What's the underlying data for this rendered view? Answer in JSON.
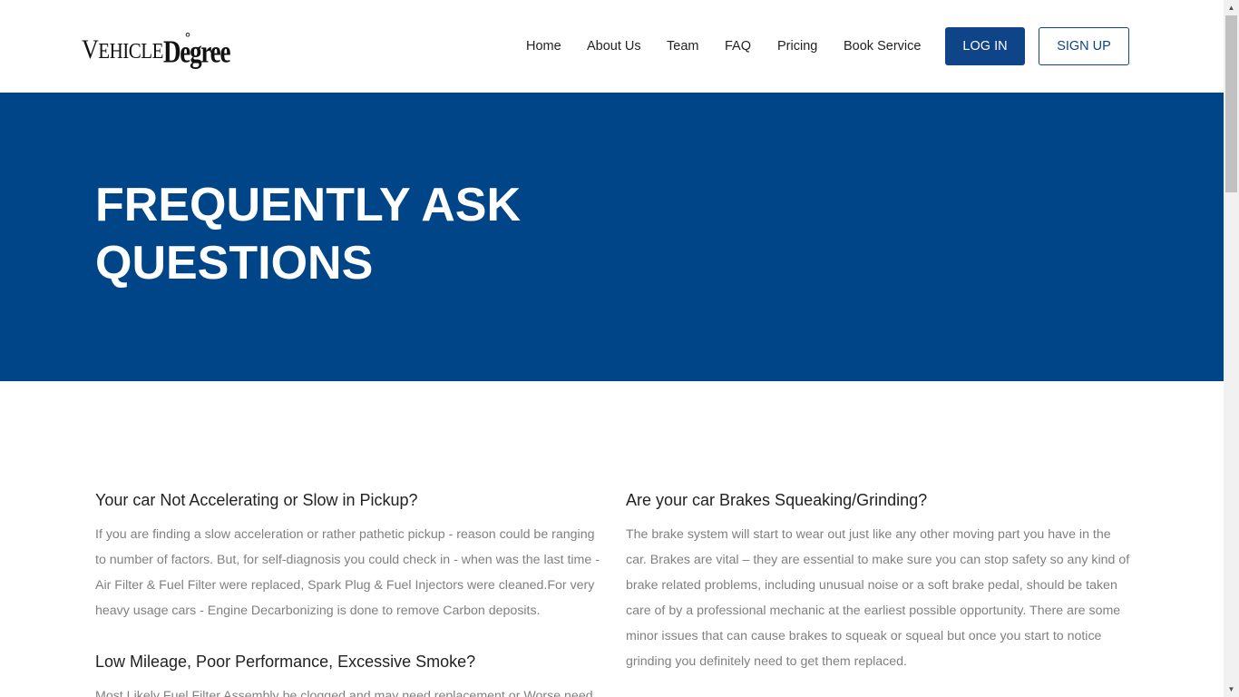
{
  "header": {
    "logo": {
      "small": "Vehicle",
      "big": "Degree",
      "mark": "°"
    },
    "nav": [
      "Home",
      "About Us",
      "Team",
      "FAQ",
      "Pricing",
      "Book Service"
    ],
    "login_label": "LOG IN",
    "signup_label": "SIGN UP"
  },
  "hero": {
    "title": "FREQUENTLY ASK QUESTIONS",
    "background": "#004588"
  },
  "faq": {
    "left": [
      {
        "question": "Your car Not Accelerating or Slow in Pickup?",
        "answer": "If you are finding a slow acceleration or rather pathetic pickup - reason could be ranging to number of factors. But, for self-diagnosis you could check in - when was the last time - Air Filter & Fuel Filter were replaced, Spark Plug & Fuel Injectors were cleaned.For very heavy usage cars - Engine Decarbonizing is done to remove Carbon deposits."
      },
      {
        "question": "Low Mileage, Poor Performance, Excessive Smoke?",
        "answer": "Most Likely Fuel Filter Assembly be clogged and may need replacement or Worse need"
      }
    ],
    "right": [
      {
        "question": "Are your car Brakes Squeaking/Grinding?",
        "answer": "The brake system will start to wear out just like any other moving part you have in the car. Brakes are vital – they are essential to make sure you can stop safety so any kind of brake related problems, including unusual noise or a soft brake pedal, should be taken care of by a professional mechanic at the earliest possible opportunity. There are some minor issues that can cause brakes to squeak or squeal but once you start to notice grinding you definitely need to get them replaced."
      }
    ]
  },
  "colors": {
    "primary": "#0f4489",
    "muted_text": "#808080"
  }
}
